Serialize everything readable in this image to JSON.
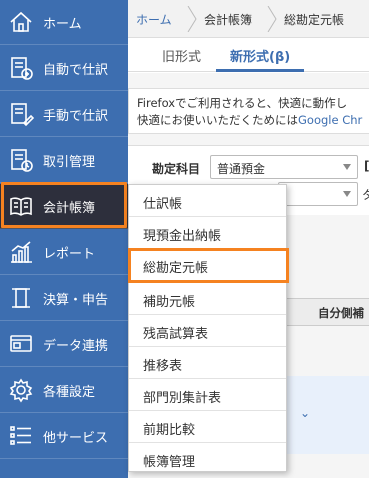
{
  "sidebar": {
    "items": [
      {
        "label": "ホーム",
        "icon": "home-icon"
      },
      {
        "label": "自動で仕訳",
        "icon": "auto-journal-icon"
      },
      {
        "label": "手動で仕訳",
        "icon": "manual-journal-icon"
      },
      {
        "label": "取引管理",
        "icon": "transaction-icon"
      },
      {
        "label": "会計帳簿",
        "icon": "book-icon"
      },
      {
        "label": "レポート",
        "icon": "chart-icon"
      },
      {
        "label": "決算・申告",
        "icon": "tax-return-icon"
      },
      {
        "label": "データ連携",
        "icon": "data-link-icon"
      },
      {
        "label": "各種設定",
        "icon": "gear-icon"
      },
      {
        "label": "他サービス",
        "icon": "list-icon"
      }
    ]
  },
  "breadcrumb": {
    "home": "ホーム",
    "books": "会計帳簿",
    "current": "総勘定元帳"
  },
  "tabs": {
    "old": "旧形式",
    "new": "新形式(β)"
  },
  "notice": {
    "line1": "Firefoxでご利用されると、快適に動作し",
    "line2_prefix": "快適にお使いいただくためには",
    "line2_link": "Google Chr"
  },
  "form": {
    "account_label": "勘定科目",
    "account_value": "普通預金",
    "right_label_partial": "[",
    "tag_label": "タ"
  },
  "table": {
    "header_partial": "自分側補"
  },
  "menu": {
    "items": [
      "仕訳帳",
      "現預金出納帳",
      "総勘定元帳",
      "補助元帳",
      "残高試算表",
      "推移表",
      "部門別集計表",
      "前期比較",
      "帳簿管理"
    ]
  },
  "colors": {
    "sidebar": "#3d6eb0",
    "active": "#2d2f3c",
    "highlight": "#f58220"
  }
}
